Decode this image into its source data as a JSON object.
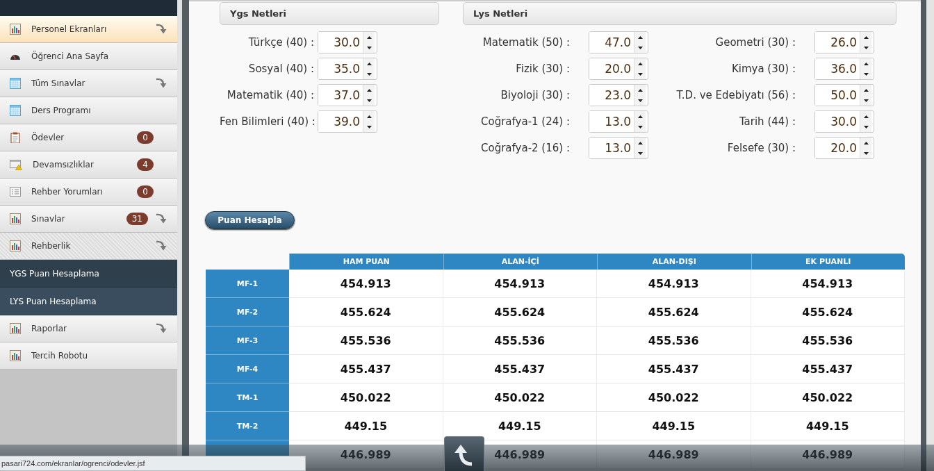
{
  "sidebar": {
    "items": [
      {
        "kind": "menu",
        "label": "Personel Ekranları",
        "highlighted": true,
        "expanded": false,
        "has_submenu": true
      },
      {
        "kind": "menu",
        "label": "Öğrenci Ana Sayfa",
        "highlighted": false,
        "expanded": false,
        "has_submenu": false
      },
      {
        "kind": "menu",
        "label": "Tüm Sınavlar",
        "highlighted": false,
        "expanded": false,
        "has_submenu": true
      },
      {
        "kind": "menu",
        "label": "Ders Programı",
        "highlighted": false,
        "expanded": false,
        "has_submenu": false
      },
      {
        "kind": "menu",
        "label": "Ödevler",
        "badge": "0",
        "highlighted": false,
        "expanded": false,
        "has_submenu": false
      },
      {
        "kind": "menu",
        "label": "Devamsızlıklar",
        "badge": "4",
        "highlighted": false,
        "expanded": false,
        "has_submenu": false
      },
      {
        "kind": "menu",
        "label": "Rehber Yorumları",
        "badge": "0",
        "highlighted": false,
        "expanded": false,
        "has_submenu": false
      },
      {
        "kind": "menu",
        "label": "Sınavlar",
        "badge": "31",
        "highlighted": false,
        "expanded": false,
        "has_submenu": true
      },
      {
        "kind": "menu",
        "label": "Rehberlik",
        "highlighted": false,
        "expanded": true,
        "has_submenu": true
      },
      {
        "kind": "submenu",
        "label": "YGS Puan Hesaplama",
        "selected": false
      },
      {
        "kind": "submenu",
        "label": "LYS Puan Hesaplama",
        "selected": true
      },
      {
        "kind": "menu",
        "label": "Raporlar",
        "highlighted": false,
        "expanded": false,
        "has_submenu": true
      },
      {
        "kind": "menu",
        "label": "Tercih Robotu",
        "highlighted": false,
        "expanded": false,
        "has_submenu": false
      }
    ]
  },
  "ygs": {
    "title": "Ygs Netleri",
    "fields": [
      {
        "label": "Türkçe (40) :",
        "value": "30.0"
      },
      {
        "label": "Sosyal (40) :",
        "value": "35.0"
      },
      {
        "label": "Matematik (40) :",
        "value": "37.0"
      },
      {
        "label": "Fen Bilimleri (40) :",
        "value": "39.0"
      }
    ]
  },
  "lys": {
    "title": "Lys Netleri",
    "columns": [
      [
        {
          "label": "Matematik (50) :",
          "value": "47.0"
        },
        {
          "label": "Fizik (30) :",
          "value": "20.0"
        },
        {
          "label": "Biyoloji (30) :",
          "value": "23.0"
        },
        {
          "label": "Coğrafya-1 (24) :",
          "value": "13.0"
        },
        {
          "label": "Coğrafya-2 (16) :",
          "value": "13.0"
        }
      ],
      [
        {
          "label": "Geometri (30) :",
          "value": "26.0"
        },
        {
          "label": "Kimya (30) :",
          "value": "36.0"
        },
        {
          "label": "T.D. ve Edebiyatı (56) :",
          "value": "50.0"
        },
        {
          "label": "Tarih (44) :",
          "value": "30.0"
        },
        {
          "label": "Felsefe (30) :",
          "value": "20.0"
        }
      ]
    ]
  },
  "calculate_button": "Puan Hesapla",
  "table": {
    "columns": [
      "HAM PUAN",
      "ALAN-İÇİ",
      "ALAN-DIŞI",
      "EK PUANLI"
    ],
    "rows": [
      {
        "label": "MF-1",
        "cells": [
          "454.913",
          "454.913",
          "454.913",
          "454.913"
        ]
      },
      {
        "label": "MF-2",
        "cells": [
          "455.624",
          "455.624",
          "455.624",
          "455.624"
        ]
      },
      {
        "label": "MF-3",
        "cells": [
          "455.536",
          "455.536",
          "455.536",
          "455.536"
        ]
      },
      {
        "label": "MF-4",
        "cells": [
          "455.437",
          "455.437",
          "455.437",
          "455.437"
        ]
      },
      {
        "label": "TM-1",
        "cells": [
          "450.022",
          "450.022",
          "450.022",
          "450.022"
        ]
      },
      {
        "label": "TM-2",
        "cells": [
          "449.15",
          "449.15",
          "449.15",
          "449.15"
        ]
      },
      {
        "cells": [
          "446.989",
          "446.989",
          "446.989",
          "446.989"
        ]
      }
    ]
  },
  "status_bar": {
    "url": "pasari724.com/ekranlar/ogrenci/odevler.jsf"
  }
}
